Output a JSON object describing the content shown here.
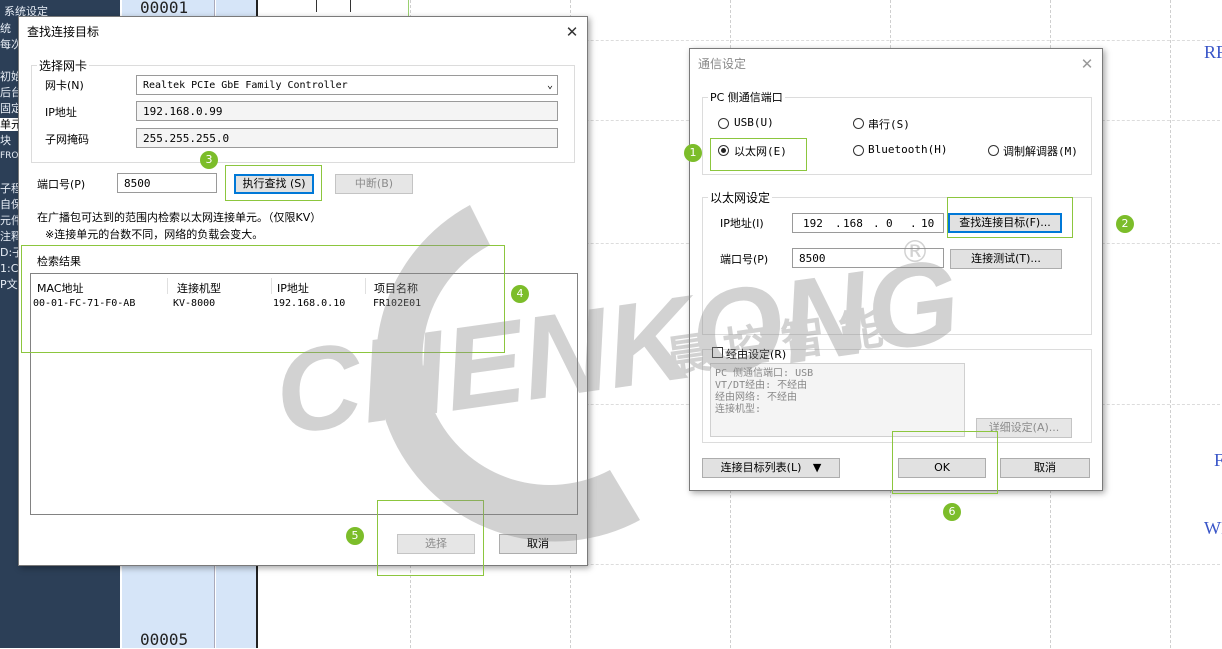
{
  "app": {
    "left_panel_title": "系统设定",
    "left_panel_fragments": [
      "统",
      "每次",
      "初始",
      "后台",
      "固定",
      "单元",
      "块",
      "FROM",
      "子程",
      "自保",
      "元件",
      "注释",
      "D:子",
      "1:C",
      "P文"
    ],
    "rung_numbers": [
      "00001",
      "00005"
    ],
    "right_labels": [
      "RF",
      "F",
      "WR"
    ]
  },
  "watermark": {
    "brand": "CHENKONG",
    "cn": "晨控智能",
    "reg": "®"
  },
  "find_dialog": {
    "title": "查找连接目标",
    "nic_group": "选择网卡",
    "nic_label": "网卡(N)",
    "nic_value": "Realtek PCIe GbE Family Controller",
    "ip_label": "IP地址",
    "ip_value": "192.168.0.99",
    "mask_label": "子网掩码",
    "mask_value": "255.255.255.0",
    "port_label": "端口号(P)",
    "port_value": "8500",
    "search_btn": "执行查找 (S)",
    "stop_btn": "中断(B)",
    "info_line1": "在广播包可达到的范围内检索以太网连接单元。（仅限KV）",
    "info_line2": "※连接单元的台数不同，网络的负载会变大。",
    "results_label": "检索结果",
    "columns": [
      "MAC地址",
      "连接机型",
      "IP地址",
      "项目名称"
    ],
    "rows": [
      [
        "00-01-FC-71-F0-AB",
        "KV-8000",
        "192.168.0.10",
        "FR102E01"
      ]
    ],
    "select_btn": "选择",
    "cancel_btn": "取消",
    "close_glyph": "✕"
  },
  "comm_dialog": {
    "title": "通信设定",
    "pc_port_group": "PC 侧通信端口",
    "radios": [
      "USB(U)",
      "串行(S)",
      "以太网(E)",
      "Bluetooth(H)",
      "调制解调器(M)"
    ],
    "selected_radio": "以太网(E)",
    "eth_group": "以太网设定",
    "ip_label": "IP地址(I)",
    "ip_parts": [
      "192",
      "168",
      "0",
      "10"
    ],
    "ip_dot": ".",
    "find_target_btn": "查找连接目标(F)...",
    "port_label": "端口号(P)",
    "port_value": "8500",
    "conn_test_btn": "连接测试(T)...",
    "route_checkbox": "经由设定(R)",
    "route_info": [
      "PC 侧通信端口: USB",
      "VT/DT经由: 不经由",
      "经由网络: 不经由",
      "连接机型:"
    ],
    "detail_btn": "详细设定(A)...",
    "target_list_btn": "连接目标列表(L)",
    "target_list_arrow": "▼",
    "ok_btn": "OK",
    "cancel_btn": "取消",
    "close_glyph": "✕"
  },
  "badges": [
    "1",
    "2",
    "3",
    "4",
    "5",
    "6"
  ],
  "colors": {
    "highlight": "#8cc63e",
    "badge": "#7cbd2a",
    "focus": "#0078d7",
    "panel": "#2c3f57",
    "ladder_col": "#d6e5f8"
  }
}
